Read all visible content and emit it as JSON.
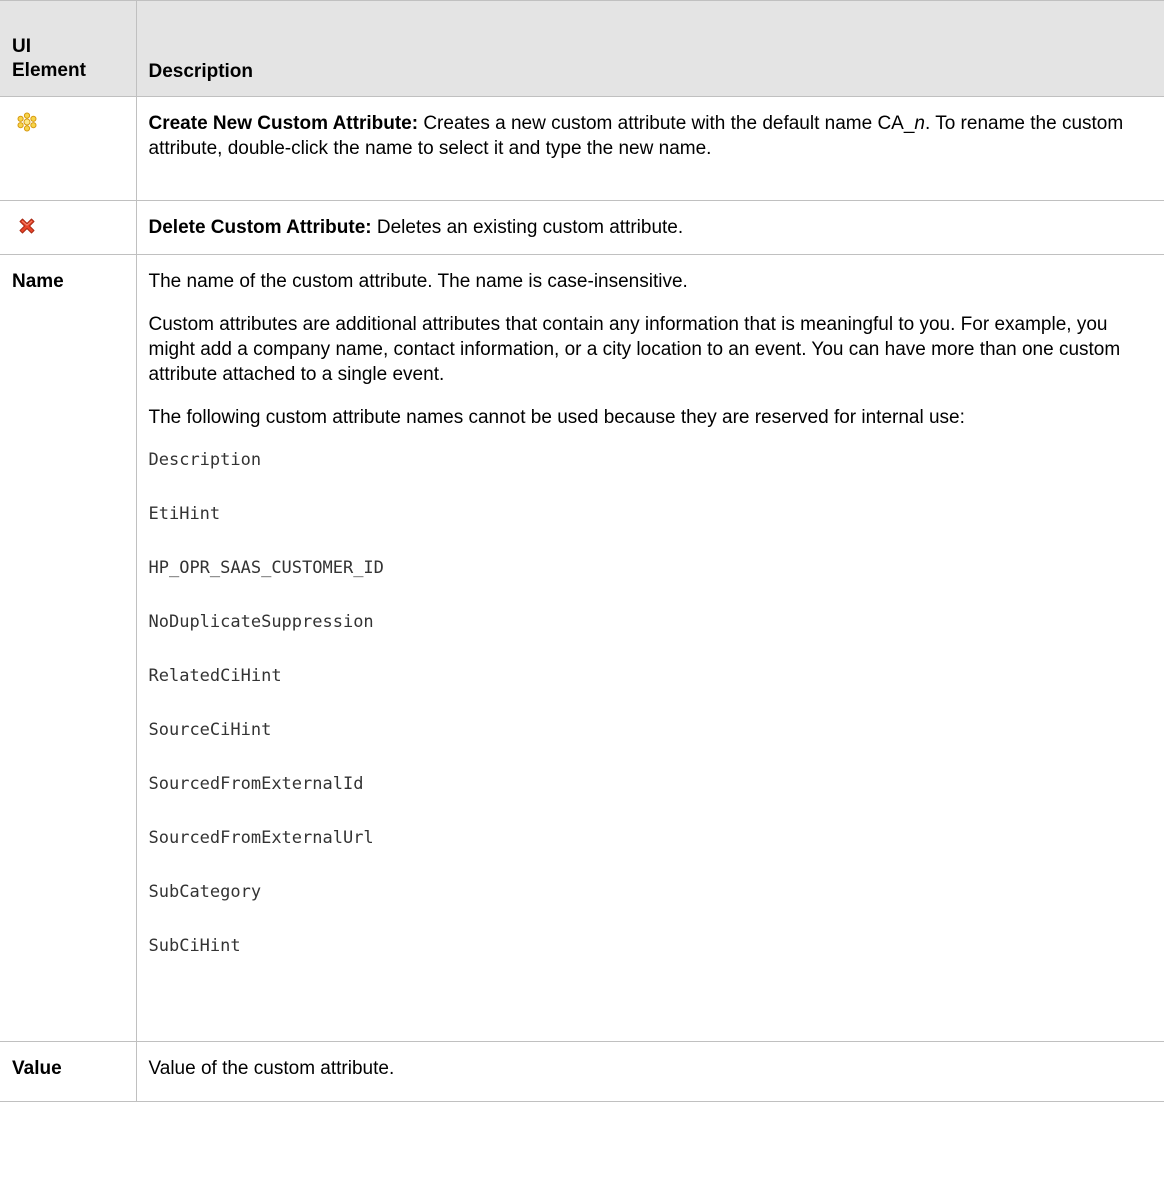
{
  "header": {
    "col_ui_element_line1": "UI",
    "col_ui_element_line2": "Element",
    "col_description": "Description"
  },
  "rows": {
    "create": {
      "icon": "asterisk-star-icon",
      "title": "Create New Custom Attribute:",
      "text_before": " Creates a new custom attribute with the default name CA_",
      "text_italic": "n",
      "text_after": ". To rename the custom attribute, double-click the name to select it and type the new name."
    },
    "delete": {
      "icon": "red-x-delete-icon",
      "title": "Delete Custom Attribute:",
      "text": " Deletes an existing custom attribute."
    },
    "name": {
      "label": "Name",
      "p1": "The name of the custom attribute. The name is case-insensitive.",
      "p2": "Custom attributes are additional attributes that contain any information that is meaningful to you. For example, you might add a company name, contact information, or a city location to an event. You can have more than one custom attribute attached to a single event.",
      "p3": "The following custom attribute names cannot be used because they are reserved for internal use:",
      "reserved": [
        "Description",
        "EtiHint",
        "HP_OPR_SAAS_CUSTOMER_ID",
        "NoDuplicateSuppression",
        "RelatedCiHint",
        "SourceCiHint",
        "SourcedFromExternalId",
        "SourcedFromExternalUrl",
        "SubCategory",
        "SubCiHint"
      ]
    },
    "value": {
      "label": "Value",
      "text": "Value of the custom attribute."
    }
  },
  "colors": {
    "header_bg": "#e4e4e4",
    "border": "#c0c0c0",
    "create_icon": "#f2c230",
    "delete_icon": "#e03a1e"
  }
}
